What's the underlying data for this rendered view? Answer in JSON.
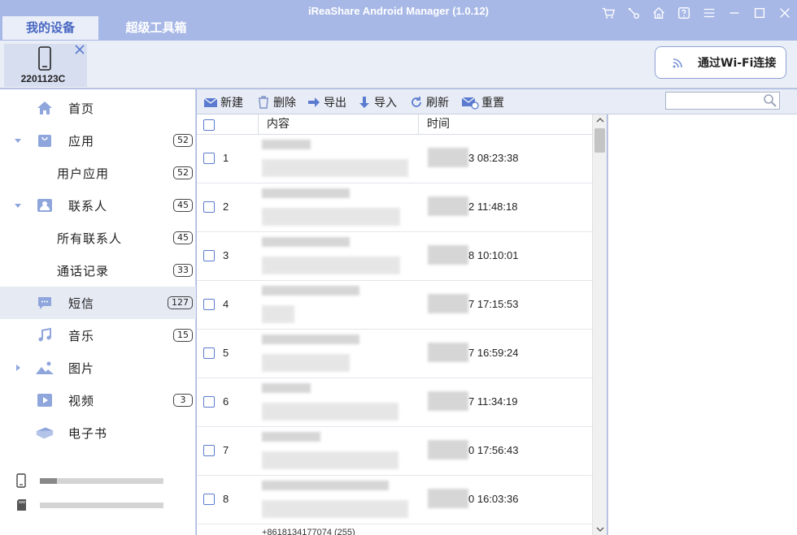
{
  "window": {
    "title": "iReaShare Android Manager (1.0.12)",
    "tabs": [
      "我的设备",
      "超级工具箱"
    ],
    "controls": [
      "cart-icon",
      "key-icon",
      "home-icon",
      "help-icon",
      "menu-icon",
      "minimize-icon",
      "maximize-icon",
      "close-icon"
    ]
  },
  "device": {
    "name": "2201123C"
  },
  "wifi_button": {
    "label": "通过Wi-Fi连接"
  },
  "sidebar": {
    "items": [
      {
        "label": "首页",
        "badge": ""
      },
      {
        "label": "应用",
        "badge": "52"
      },
      {
        "label": "用户应用",
        "badge": "52"
      },
      {
        "label": "联系人",
        "badge": "45"
      },
      {
        "label": "所有联系人",
        "badge": "45"
      },
      {
        "label": "通话记录",
        "badge": "33"
      },
      {
        "label": "短信",
        "badge": "127"
      },
      {
        "label": "音乐",
        "badge": "15"
      },
      {
        "label": "图片",
        "badge": ""
      },
      {
        "label": "视频",
        "badge": "3"
      },
      {
        "label": "电子书",
        "badge": ""
      }
    ],
    "storage": [
      {
        "type": "phone-storage",
        "used_fraction": 0.14
      },
      {
        "type": "sd-card",
        "used_fraction": 0.0
      }
    ]
  },
  "toolbar": {
    "new": "新建",
    "delete": "删除",
    "export": "导出",
    "import": "导入",
    "refresh": "刷新",
    "reset": "重置",
    "search_placeholder": ""
  },
  "table": {
    "headers": [
      "内容",
      "时间"
    ],
    "rows": [
      {
        "index": "1",
        "time": "3 08:23:38"
      },
      {
        "index": "2",
        "time": "2 11:48:18"
      },
      {
        "index": "3",
        "time": "8 10:10:01"
      },
      {
        "index": "4",
        "time": "7 17:15:53"
      },
      {
        "index": "5",
        "time": "7 16:59:24"
      },
      {
        "index": "6",
        "time": "7 11:34:19"
      },
      {
        "index": "7",
        "time": "0 17:56:43"
      },
      {
        "index": "8",
        "time": "0 16:03:36"
      }
    ],
    "partial_row": "+8618134177074 (255)"
  },
  "colors": {
    "titlebar": "#a8b8e6",
    "accent": "#4867c2",
    "checkbox": "#5b7bd0"
  }
}
